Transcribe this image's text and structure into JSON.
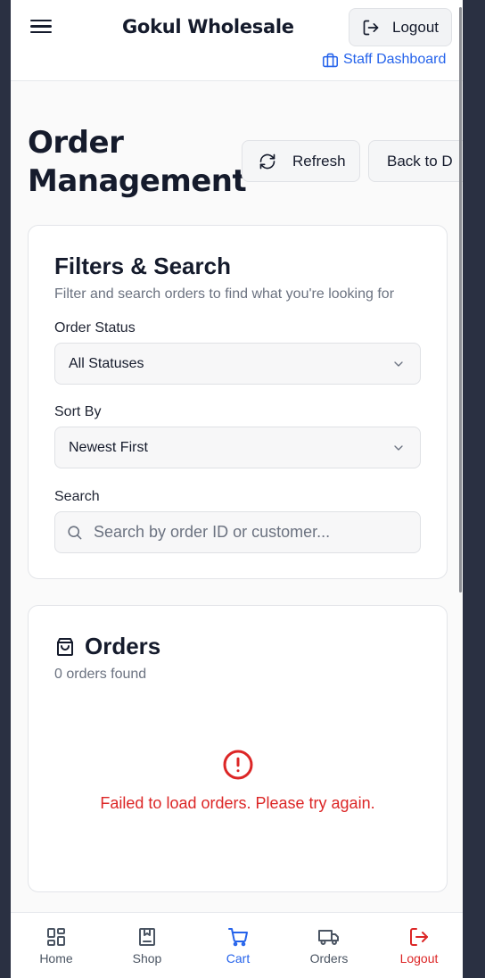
{
  "header": {
    "brand": "Gokul Wholesale",
    "logout_label": "Logout",
    "staff_link": "Staff Dashboard"
  },
  "page": {
    "title_line1": "Order",
    "title_line2": "Management",
    "refresh_label": "Refresh",
    "back_label": "Back to D"
  },
  "filters": {
    "title": "Filters & Search",
    "subtitle": "Filter and search orders to find what you're looking for",
    "status_label": "Order Status",
    "status_value": "All Statuses",
    "sort_label": "Sort By",
    "sort_value": "Newest First",
    "search_label": "Search",
    "search_placeholder": "Search by order ID or customer..."
  },
  "orders": {
    "title": "Orders",
    "count": "0 orders found",
    "error": "Failed to load orders. Please try again."
  },
  "nav": [
    {
      "label": "Home",
      "icon": "grid-icon"
    },
    {
      "label": "Shop",
      "icon": "bookmark-box-icon"
    },
    {
      "label": "Cart",
      "icon": "cart-icon"
    },
    {
      "label": "Orders",
      "icon": "truck-icon"
    },
    {
      "label": "Logout",
      "icon": "logout-icon"
    }
  ],
  "colors": {
    "accent": "#2563eb",
    "danger": "#dc2626",
    "text": "#151b2c"
  }
}
